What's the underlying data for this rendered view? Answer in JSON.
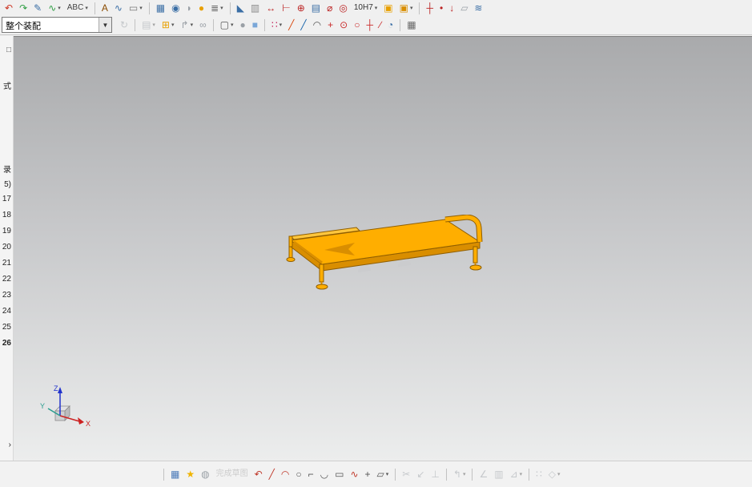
{
  "colors": {
    "model-fill": "#ffae00",
    "model-dark": "#d98e00",
    "model-edge": "#8f5e00",
    "model-light": "#ffc63d",
    "axis-x": "#cc2222",
    "axis-y": "#2a9d8f",
    "axis-z": "#2233cc",
    "viewport-top": "#a9aaac",
    "viewport-bottom": "#eceded"
  },
  "assembly_combo": {
    "value": "整个装配"
  },
  "toolbar_top": {
    "items": [
      {
        "name": "studio-spline-icon",
        "glyph": "↶",
        "color": "#cc3322"
      },
      {
        "name": "art-spline-icon",
        "glyph": "↷",
        "color": "#2f9e44"
      },
      {
        "name": "curve-pencil-icon",
        "glyph": "✎",
        "color": "#3a6ea5"
      },
      {
        "name": "fit-curve-icon",
        "glyph": "∿",
        "color": "#2f9e44",
        "dd": true
      },
      {
        "name": "abc-annotation-icon",
        "label": "ABC",
        "color": "#444",
        "dd": true
      },
      {
        "sep": true
      },
      {
        "name": "text-tool-icon",
        "glyph": "A",
        "color": "#8a4b00"
      },
      {
        "name": "surface-text-icon",
        "glyph": "∿",
        "color": "#3a6ea5"
      },
      {
        "name": "label-style-icon",
        "glyph": "▭",
        "color": "#777",
        "dd": true
      },
      {
        "sep": true
      },
      {
        "name": "datum-grid-icon",
        "glyph": "▦",
        "color": "#3a6ea5"
      },
      {
        "name": "sphere-tool-icon",
        "glyph": "◉",
        "color": "#3a6ea5"
      },
      {
        "name": "shell-tool-icon",
        "glyph": "◗",
        "color": "#9aa0a6"
      },
      {
        "name": "sphere-orange-icon",
        "glyph": "●",
        "color": "#e8a000"
      },
      {
        "name": "layer-stack-icon",
        "glyph": "≣",
        "color": "#666",
        "dd": true
      },
      {
        "sep": true
      },
      {
        "name": "angle-tool-icon",
        "glyph": "◣",
        "color": "#3a6ea5"
      },
      {
        "name": "ruler-icon",
        "glyph": "▥",
        "color": "#8a8a8a"
      },
      {
        "name": "linear-dimension-icon",
        "glyph": "↔",
        "color": "#bb2222"
      },
      {
        "name": "distance-dimension-icon",
        "glyph": "⊢",
        "color": "#bb2222"
      },
      {
        "name": "target-point-icon",
        "glyph": "⊕",
        "color": "#bb2222"
      },
      {
        "name": "screen-display-icon",
        "glyph": "▤",
        "color": "#3a6ea5"
      },
      {
        "name": "diameter-dimension-icon",
        "glyph": "⌀",
        "color": "#bb2222"
      },
      {
        "name": "radial-dimension-icon",
        "glyph": "◎",
        "color": "#bb2222"
      },
      {
        "name": "tolerance-combo",
        "label": "10H7",
        "color": "#333",
        "dd": true
      },
      {
        "name": "extrude-block-icon",
        "glyph": "▣",
        "color": "#e8a000"
      },
      {
        "name": "unite-block-icon",
        "glyph": "▣",
        "color": "#d98e00",
        "dd": true
      },
      {
        "sep": true
      },
      {
        "name": "datum-axis-icon",
        "glyph": "┼",
        "color": "#bb2222"
      },
      {
        "name": "point-tool-icon",
        "glyph": "•",
        "color": "#bb2222"
      },
      {
        "name": "pin-marker-icon",
        "glyph": "↓",
        "color": "#bb2222"
      },
      {
        "name": "sheet-body-icon",
        "glyph": "▱",
        "color": "#9aa0a6"
      },
      {
        "name": "sew-surface-icon",
        "glyph": "≋",
        "color": "#3a6ea5"
      }
    ]
  },
  "toolbar_snap": {
    "items": [
      {
        "name": "motion-lock-icon",
        "glyph": "↻",
        "color": "#9aa0a6",
        "disabled": true
      },
      {
        "sep": true
      },
      {
        "name": "paste-special-icon",
        "glyph": "▤",
        "color": "#9aa0a6",
        "dd": true,
        "disabled": true
      },
      {
        "name": "add-component-icon",
        "glyph": "⊞",
        "color": "#e8a000",
        "dd": true
      },
      {
        "name": "move-component-icon",
        "glyph": "↱",
        "color": "#9aa0a6",
        "dd": true
      },
      {
        "name": "assembly-constraints-icon",
        "glyph": "∞",
        "color": "#9aa0a6"
      },
      {
        "sep": true
      },
      {
        "name": "selection-filter-icon",
        "glyph": "▢",
        "color": "#555",
        "dd": true
      },
      {
        "name": "snap-sphere-icon",
        "glyph": "●",
        "color": "#9aa0a6"
      },
      {
        "name": "snap-cube-icon",
        "glyph": "■",
        "color": "#7aa7d8"
      },
      {
        "sep": true
      },
      {
        "name": "snap-point-menu-icon",
        "glyph": "∷",
        "color": "#c2255c",
        "dd": true
      },
      {
        "name": "snap-endpoint-icon",
        "glyph": "╱",
        "color": "#d9480f"
      },
      {
        "name": "snap-midpoint-icon",
        "glyph": "╱",
        "color": "#1864ab"
      },
      {
        "name": "snap-control-point-icon",
        "glyph": "◠",
        "color": "#555"
      },
      {
        "name": "snap-intersection-icon",
        "glyph": "+",
        "color": "#c92a2a"
      },
      {
        "name": "snap-arc-center-icon",
        "glyph": "⊙",
        "color": "#c92a2a"
      },
      {
        "name": "snap-quadrant-icon",
        "glyph": "○",
        "color": "#c92a2a"
      },
      {
        "name": "snap-existing-point-icon",
        "glyph": "┼",
        "color": "#c92a2a"
      },
      {
        "name": "snap-point-on-curve-icon",
        "glyph": "∕",
        "color": "#c92a2a"
      },
      {
        "name": "snap-point-on-face-icon",
        "glyph": "◔",
        "color": "#3a6ea5"
      },
      {
        "sep": true
      },
      {
        "name": "data-table-icon",
        "glyph": "▦",
        "color": "#666"
      }
    ]
  },
  "sidebar": {
    "items": [
      "□",
      "式",
      "录",
      "5)",
      "17",
      "18",
      "19",
      "20",
      "21",
      "22",
      "23",
      "24",
      "25",
      "26",
      "›"
    ]
  },
  "triad": {
    "x_label": "X",
    "y_label": "Y",
    "z_label": "Z"
  },
  "toolbar_sketch": {
    "items": [
      {
        "sep": true
      },
      {
        "name": "sketch-scene-icon",
        "glyph": "▦",
        "color": "#4a79b8"
      },
      {
        "name": "sketch-star-icon",
        "glyph": "★",
        "color": "#f0b400"
      },
      {
        "name": "render-checker-icon",
        "glyph": "◍",
        "color": "#9aa0a6"
      },
      {
        "name": "finish-sketch-label",
        "label": "完成草图",
        "color": "#a8a8a8",
        "disabled": true
      },
      {
        "name": "profile-icon",
        "glyph": "↶",
        "color": "#c0392b"
      },
      {
        "name": "line-icon",
        "glyph": "╱",
        "color": "#c0392b"
      },
      {
        "name": "arc-icon",
        "glyph": "◠",
        "color": "#c0392b"
      },
      {
        "name": "circle-icon",
        "glyph": "○",
        "color": "#555"
      },
      {
        "name": "arc-corner-icon",
        "glyph": "⌐",
        "color": "#555"
      },
      {
        "name": "fillet-icon",
        "glyph": "◡",
        "color": "#555"
      },
      {
        "name": "rectangle-icon",
        "glyph": "▭",
        "color": "#555"
      },
      {
        "name": "studio-spline-curve-icon",
        "glyph": "∿",
        "color": "#c0392b"
      },
      {
        "name": "point-icon",
        "glyph": "+",
        "color": "#555"
      },
      {
        "name": "offset-curve-icon",
        "glyph": "▱",
        "color": "#555",
        "dd": true
      },
      {
        "sep": true
      },
      {
        "name": "quick-trim-icon",
        "glyph": "✂",
        "color": "#9aa0a6",
        "disabled": true
      },
      {
        "name": "quick-extend-icon",
        "glyph": "↙",
        "color": "#9aa0a6",
        "disabled": true
      },
      {
        "name": "make-corner-icon",
        "glyph": "⊥",
        "color": "#9aa0a6",
        "disabled": true
      },
      {
        "sep": true
      },
      {
        "name": "edit-curve-icon",
        "glyph": "↰",
        "color": "#9aa0a6",
        "dd": true,
        "disabled": true
      },
      {
        "sep": true
      },
      {
        "name": "chamfer-icon",
        "glyph": "∠",
        "color": "#9aa0a6",
        "disabled": true
      },
      {
        "name": "dimension-grid-icon",
        "glyph": "▥",
        "color": "#9aa0a6",
        "disabled": true
      },
      {
        "name": "constraints-icon",
        "glyph": "⊿",
        "color": "#9aa0a6",
        "dd": true,
        "disabled": true
      },
      {
        "sep": true
      },
      {
        "name": "pattern-curve-icon",
        "glyph": "∷",
        "color": "#9aa0a6",
        "disabled": true
      },
      {
        "name": "mirror-curve-icon",
        "glyph": "◇",
        "color": "#9aa0a6",
        "disabled": true,
        "dd": true
      }
    ]
  }
}
